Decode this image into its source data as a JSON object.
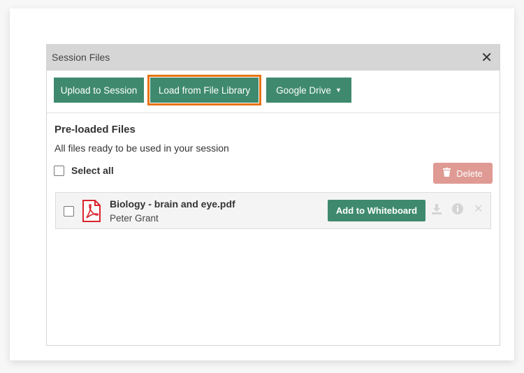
{
  "dialog": {
    "title": "Session Files",
    "close_icon": "close-icon"
  },
  "toolbar": {
    "upload_label": "Upload to Session",
    "library_label": "Load from File Library",
    "drive_label": "Google Drive",
    "highlight_color": "#e8730f",
    "button_color": "#3f8a6f"
  },
  "section": {
    "title": "Pre-loaded Files",
    "subtitle": "All files ready to be used in your session",
    "select_all_label": "Select all",
    "delete_label": "Delete",
    "delete_color": "#df9a93"
  },
  "files": [
    {
      "name": "Biology - brain and eye.pdf",
      "owner": "Peter Grant",
      "type_icon": "pdf-icon",
      "action_label": "Add to Whiteboard",
      "icons": [
        "download-icon",
        "info-icon",
        "remove-icon"
      ]
    }
  ]
}
